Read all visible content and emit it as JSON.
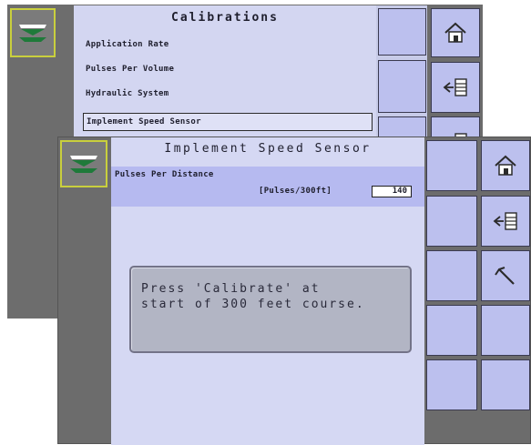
{
  "back_screen": {
    "title": "Calibrations",
    "menu_items": [
      "Application Rate",
      "Pulses Per Volume",
      "Hydraulic System",
      "Implement Speed Sensor"
    ],
    "selected_index": 3,
    "side_icon": "spreader-icon",
    "right_icons": [
      "home-icon",
      "back-list-icon",
      "back-list-icon"
    ]
  },
  "front_screen": {
    "title": "Implement Speed Sensor",
    "field_label": "Pulses Per Distance",
    "field_unit": "[Pulses/300ft]",
    "field_value": "140",
    "message_line1": "Press 'Calibrate' at",
    "message_line2": "start of 300 feet course.",
    "side_icon": "spreader-icon",
    "right_icons": [
      "home-icon",
      "back-list-icon",
      "calibrate-tool-icon"
    ]
  },
  "colors": {
    "screen_bg": "#d5d8f3",
    "gray_bar": "#6c6c6c",
    "softkey": "#bcc0ee",
    "selected_icon_border": "#c9cf3d",
    "field_strip": "#b6baf0"
  }
}
